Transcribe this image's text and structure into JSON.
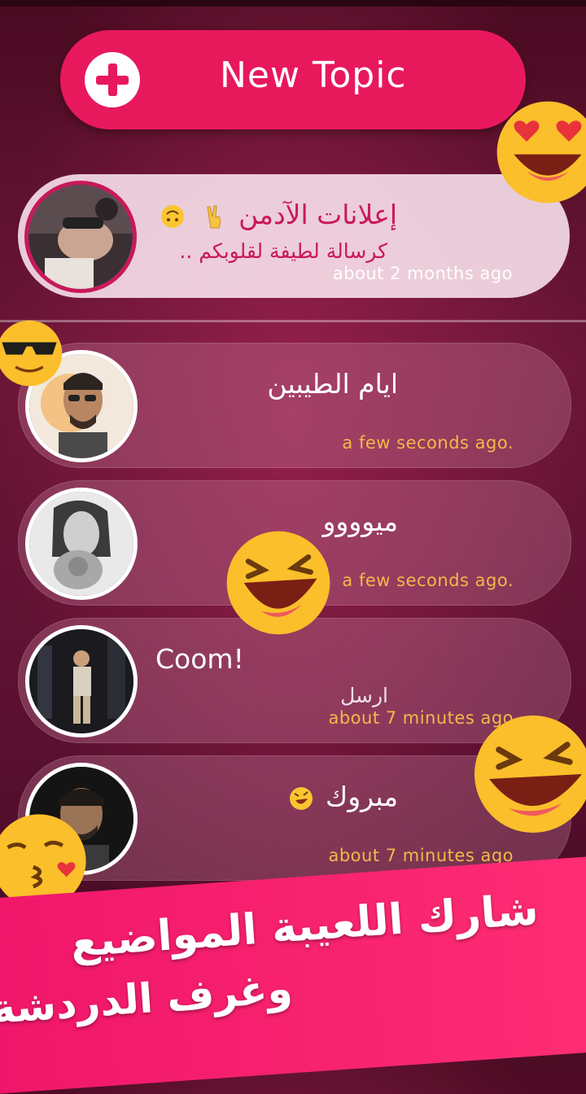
{
  "new_topic": {
    "label": "New Topic",
    "icon": "plus-icon",
    "color": "#e8185c"
  },
  "pinned_topic": {
    "title": "إعلانات الآدمن",
    "emojis": [
      "victory-hand-icon",
      "upside-down-face-icon"
    ],
    "subtitle": "كرسالة لطيفة لقلوبكم ..",
    "time": "about 2 months ago"
  },
  "topics": [
    {
      "title": "ايام الطيبين",
      "subtitle": "",
      "time": "a few seconds ago."
    },
    {
      "title": "ميوووو",
      "subtitle": "",
      "time": "a few seconds ago."
    },
    {
      "title": "Coom!",
      "subtitle": "ارسل",
      "time": "about 7 minutes ago"
    },
    {
      "title": "مبروك",
      "subtitle": "",
      "time": "about 7 minutes ago",
      "emoji": "rolling-laughing-icon"
    }
  ],
  "banner": {
    "line1": "شارك اللعيبة المواضيع",
    "line2": "وغرف الدردشة",
    "color": "#f0166a"
  },
  "colors": {
    "accent": "#e8185c",
    "time_text": "#f5b84a",
    "background": "#5a1030"
  }
}
